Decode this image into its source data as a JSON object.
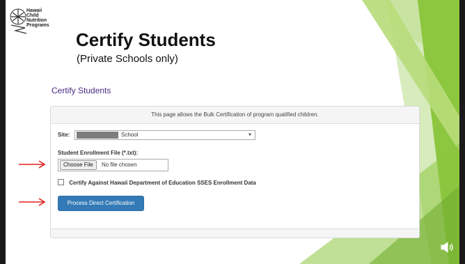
{
  "logo": {
    "lines": [
      "Hawaii",
      "Child",
      "Nutrition",
      "Programs"
    ]
  },
  "slide": {
    "title": "Certify Students",
    "subtitle": "(Private Schools only)"
  },
  "app": {
    "heading": "Certify Students",
    "description": "This page allows the Bulk Certification of program qualified children.",
    "site": {
      "label": "Site:",
      "selected_value": "School"
    },
    "enrollment_file": {
      "label": "Student Enrollment File (*.txt):",
      "button_label": "Choose File",
      "status_text": "No file chosen"
    },
    "certify_against": {
      "label": "Certify Against Hawaii Department of Education SSES Enrollment Data",
      "checked": false
    },
    "process_button_label": "Process Direct Certification"
  },
  "icons": {
    "arrow": "right-arrow-icon",
    "audio": "speaker-icon"
  },
  "colors": {
    "accent_green": "#8dc63f",
    "button_blue": "#337ab7",
    "heading_purple": "#4a2a85",
    "arrow_red": "#e02020"
  }
}
